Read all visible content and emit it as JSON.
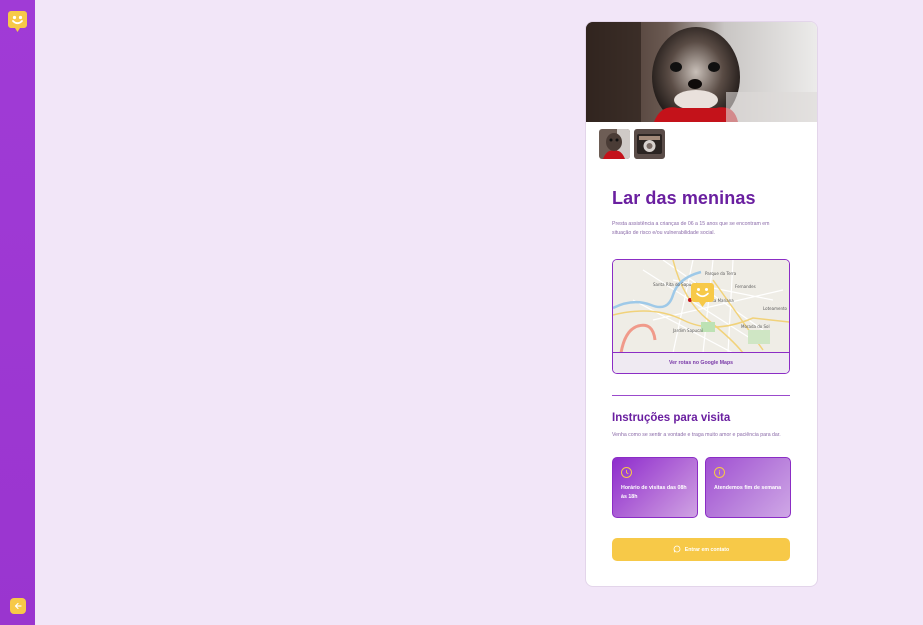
{
  "app": {
    "logo_icon": "smiley-chat-icon",
    "back_icon": "arrow-left-icon",
    "colors": {
      "sidebar": "#a03bd6",
      "accent": "#f7c948",
      "title": "#6a1fa0",
      "background": "#f2e6f8"
    }
  },
  "orphanage": {
    "name": "Lar das meninas",
    "about": "Presta assistência a crianças de 06 a 15 anos que se encontram em situação de risco e/ou vulnerabilidade social.",
    "images": [
      "dog-photo",
      "camera-photo"
    ],
    "map": {
      "link_label": "Ver rotas no Google Maps",
      "place_labels": [
        "Parque da Terra",
        "Santa Rita do Sapucaí",
        "Vila Mariana",
        "Morada do Sol",
        "Loteamento",
        "Jardim Sapucaí",
        "Fernandes"
      ]
    },
    "instructions": {
      "title": "Instruções para visita",
      "text": "Venha como se sentir a vontade e traga muito amor e paciência para dar.",
      "hours": "Horário de visitas das 08h às 18h",
      "weekends": "Atendemos fim de semana"
    },
    "contact_label": "Entrar em contato",
    "contact_icon": "whatsapp-icon"
  }
}
